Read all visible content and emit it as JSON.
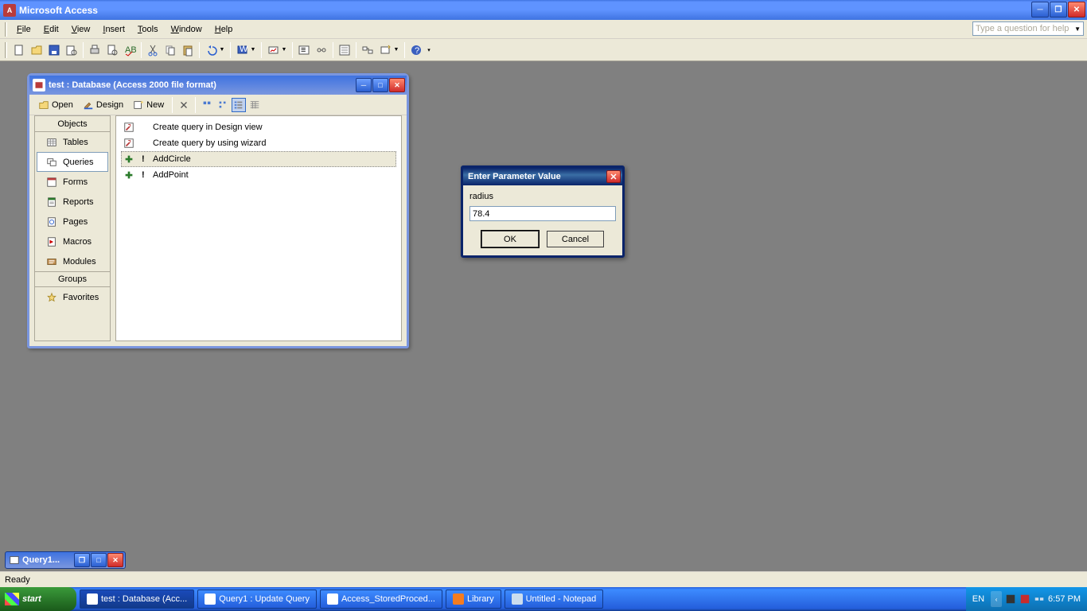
{
  "app": {
    "title": "Microsoft Access"
  },
  "menu": {
    "file": "File",
    "edit": "Edit",
    "view": "View",
    "insert": "Insert",
    "tools": "Tools",
    "window": "Window",
    "help": "Help"
  },
  "help_placeholder": "Type a question for help",
  "dbwin": {
    "title": "test : Database (Access 2000 file format)",
    "tb": {
      "open": "Open",
      "design": "Design",
      "new": "New"
    },
    "groups_header": "Objects",
    "objects": [
      {
        "label": "Tables",
        "selected": false
      },
      {
        "label": "Queries",
        "selected": true
      },
      {
        "label": "Forms",
        "selected": false
      },
      {
        "label": "Reports",
        "selected": false
      },
      {
        "label": "Pages",
        "selected": false
      },
      {
        "label": "Macros",
        "selected": false
      },
      {
        "label": "Modules",
        "selected": false
      }
    ],
    "groups_label": "Groups",
    "favorites": "Favorites",
    "content": [
      {
        "label": "Create query in Design view",
        "kind": "shortcut"
      },
      {
        "label": "Create query by using wizard",
        "kind": "shortcut"
      },
      {
        "label": "AddCircle",
        "kind": "action",
        "selected": true
      },
      {
        "label": "AddPoint",
        "kind": "action"
      }
    ]
  },
  "minimized": {
    "title": "Query1..."
  },
  "param_dialog": {
    "title": "Enter Parameter Value",
    "label": "radius",
    "value": "78.4",
    "ok": "OK",
    "cancel": "Cancel"
  },
  "status": {
    "text": "Ready"
  },
  "taskbar": {
    "start": "start",
    "items": [
      {
        "label": "test : Database (Acc...",
        "active": true
      },
      {
        "label": "Query1 : Update Query"
      },
      {
        "label": "Access_StoredProced..."
      },
      {
        "label": "Library"
      },
      {
        "label": "Untitled - Notepad"
      }
    ],
    "lang": "EN",
    "time": "6:57 PM"
  }
}
